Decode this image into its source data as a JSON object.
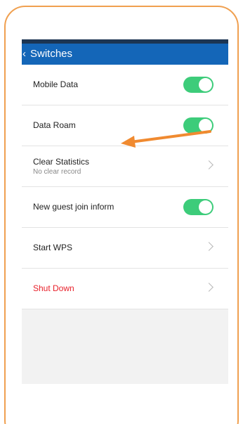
{
  "header": {
    "back_glyph": "‹",
    "title": "Switches"
  },
  "rows": [
    {
      "label": "Mobile Data",
      "control": "toggle",
      "on": true
    },
    {
      "label": "Data Roam",
      "control": "toggle",
      "on": true
    },
    {
      "label": "Clear Statistics",
      "sub": "No clear record",
      "control": "chevron"
    },
    {
      "label": "New guest join inform",
      "control": "toggle",
      "on": true
    },
    {
      "label": "Start WPS",
      "control": "chevron"
    },
    {
      "label": "Shut Down",
      "control": "chevron",
      "danger": true
    }
  ],
  "colors": {
    "frame": "#f0a050",
    "appbar": "#1466b8",
    "statusbar": "#1c3553",
    "toggle_on": "#3dcc7a",
    "danger": "#e8202a",
    "annotation_arrow": "#f08a30"
  },
  "annotation": {
    "type": "arrow",
    "points_to": "Data Roam"
  }
}
